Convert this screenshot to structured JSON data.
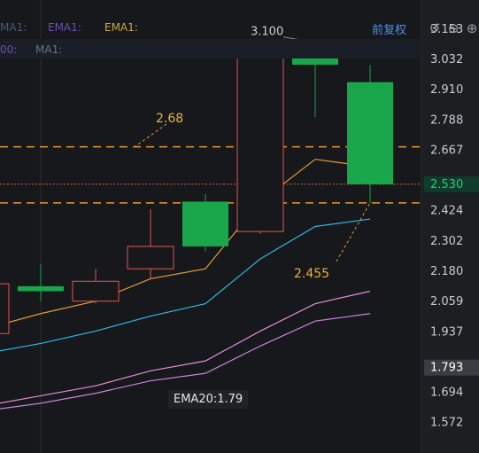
{
  "legend": {
    "row1": [
      "MA1:",
      "EMA1:",
      "EMA1:"
    ],
    "row2_left": "00:",
    "row2_ma": "MA1:"
  },
  "header": {
    "adjust_label": "前复权"
  },
  "price_axis": {
    "ticks": [
      "3.153",
      "3.032",
      "2.910",
      "2.788",
      "2.667",
      "2.530",
      "2.424",
      "2.302",
      "2.180",
      "2.059",
      "1.937",
      "1.793",
      "1.694",
      "1.572"
    ]
  },
  "annotations": {
    "high_label": "3.100",
    "upper_level_label": "2.68",
    "lower_level_label": "2.455",
    "current_price": "2.530",
    "cursor_price": "1.793"
  },
  "tooltip": {
    "text": "EMA20:1.79"
  },
  "colors": {
    "background": "#16181b",
    "up": "#e8554a",
    "down": "#1aa64a",
    "dashed_level": "#e89a2a",
    "ma_orange": "#e89a3a",
    "ma_blue": "#2fb5e6",
    "ma_pink": "#e58ad6",
    "ma_violet": "#c884dc",
    "current_price_box": "#0f3a2c"
  },
  "chart_data": {
    "type": "candlestick",
    "ohlc": [
      {
        "open": 1.93,
        "high": 2.14,
        "low": 1.9,
        "close": 2.13
      },
      {
        "open": 2.12,
        "high": 2.21,
        "low": 2.06,
        "close": 2.1
      },
      {
        "open": 2.06,
        "high": 2.19,
        "low": 2.05,
        "close": 2.14
      },
      {
        "open": 2.19,
        "high": 2.43,
        "low": 2.15,
        "close": 2.28
      },
      {
        "open": 2.46,
        "high": 2.49,
        "low": 2.26,
        "close": 2.28
      },
      {
        "open": 2.34,
        "high": 3.07,
        "low": 2.33,
        "close": 3.06
      },
      {
        "open": 3.06,
        "high": 3.1,
        "low": 2.8,
        "close": 3.01
      },
      {
        "open": 2.94,
        "high": 3.01,
        "low": 2.455,
        "close": 2.53
      }
    ],
    "levels": [
      2.68,
      2.455
    ],
    "lines": [
      {
        "name": "orange",
        "values": [
          1.95,
          2.01,
          2.06,
          2.15,
          2.19,
          2.46,
          2.63,
          2.6
        ]
      },
      {
        "name": "blue",
        "values": [
          1.85,
          1.89,
          1.94,
          2.0,
          2.05,
          2.23,
          2.36,
          2.39
        ]
      },
      {
        "name": "pink",
        "values": [
          1.64,
          1.68,
          1.72,
          1.78,
          1.82,
          1.94,
          2.05,
          2.1
        ]
      },
      {
        "name": "violet",
        "values": [
          1.62,
          1.65,
          1.69,
          1.74,
          1.77,
          1.88,
          1.98,
          2.01
        ]
      }
    ],
    "ylim": [
      1.45,
      3.27
    ]
  }
}
